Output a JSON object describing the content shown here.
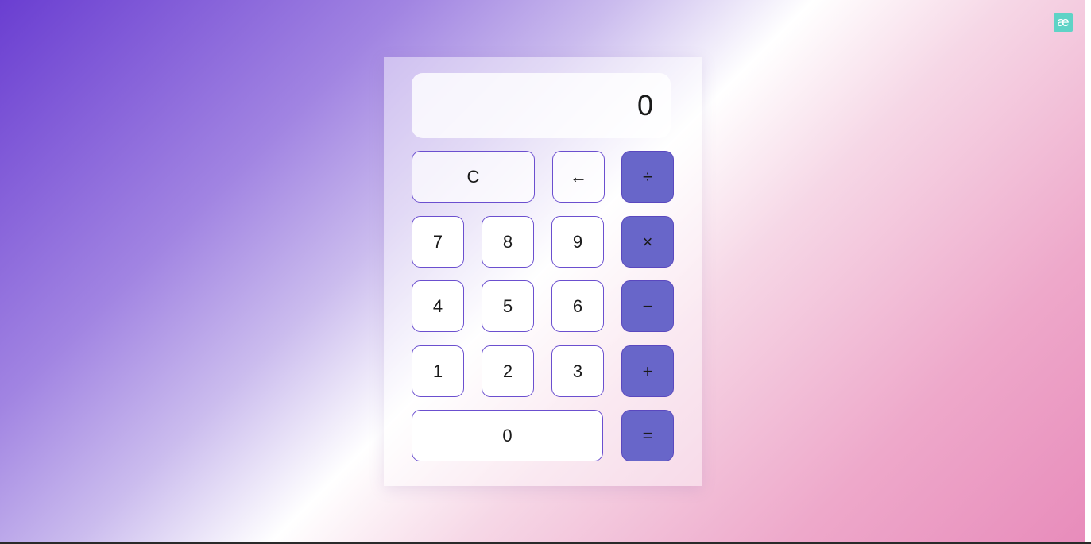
{
  "logo": {
    "text": "æ",
    "icon": "ae-logo-icon",
    "color": "#5fd3c6"
  },
  "calculator": {
    "display_value": "0",
    "buttons": {
      "clear": "C",
      "backspace": "←",
      "divide": "÷",
      "seven": "7",
      "eight": "8",
      "nine": "9",
      "multiply": "×",
      "four": "4",
      "five": "5",
      "six": "6",
      "subtract": "−",
      "one": "1",
      "two": "2",
      "three": "3",
      "add": "+",
      "zero": "0",
      "equals": "="
    }
  },
  "colors": {
    "operator_button": "#6866c9",
    "button_border": "#6b4fcf",
    "gradient_start": "#6a3ed1",
    "gradient_end": "#e88cbb"
  }
}
